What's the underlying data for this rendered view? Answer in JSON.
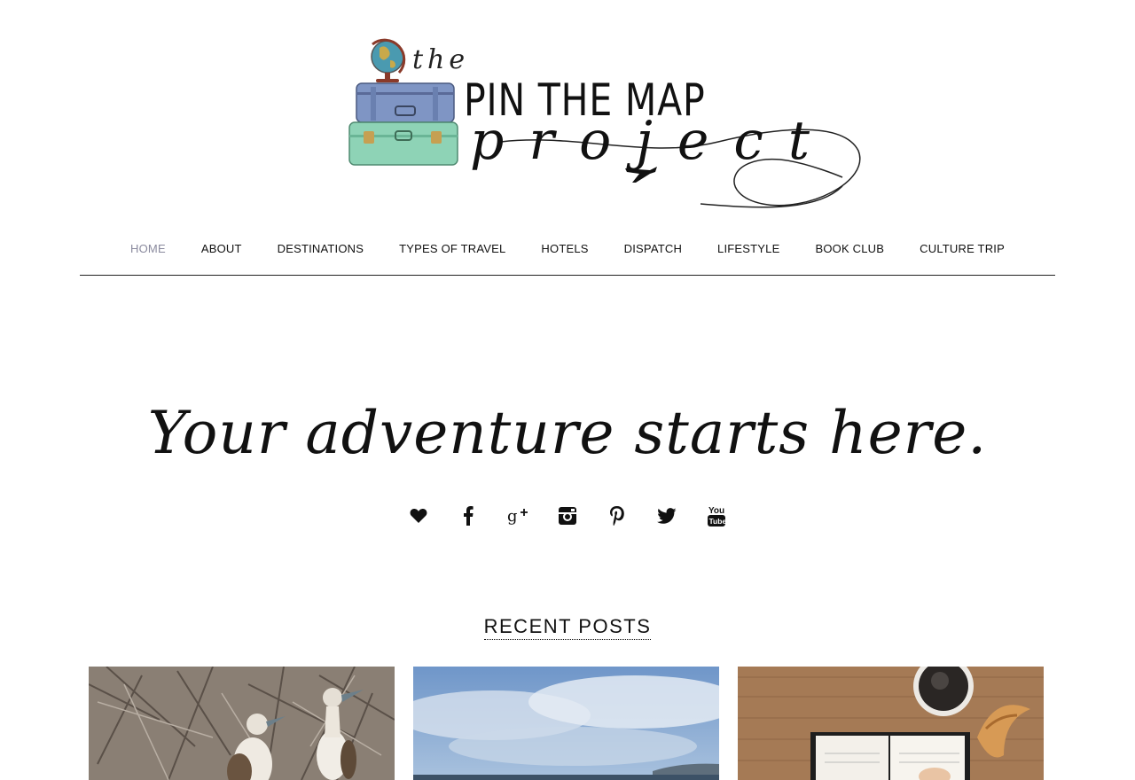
{
  "logo": {
    "the": "the",
    "title": "PIN THE MAP",
    "project": "project",
    "illustration_icon": "suitcase-globe-icon",
    "plane_icon": "airplane-icon"
  },
  "nav": {
    "items": [
      {
        "label": "HOME",
        "active": true
      },
      {
        "label": "ABOUT"
      },
      {
        "label": "DESTINATIONS"
      },
      {
        "label": "TYPES OF TRAVEL"
      },
      {
        "label": "HOTELS"
      },
      {
        "label": "DISPATCH"
      },
      {
        "label": "LIFESTYLE"
      },
      {
        "label": "BOOK CLUB"
      },
      {
        "label": "CULTURE TRIP"
      }
    ],
    "active_color": "#8a8a9e"
  },
  "tagline": "Your adventure starts here.",
  "social": {
    "icons": [
      "heart-icon",
      "facebook-icon",
      "google-plus-icon",
      "instagram-icon",
      "pinterest-icon",
      "twitter-icon",
      "youtube-icon"
    ]
  },
  "recent_posts": {
    "title": "RECENT POSTS"
  }
}
